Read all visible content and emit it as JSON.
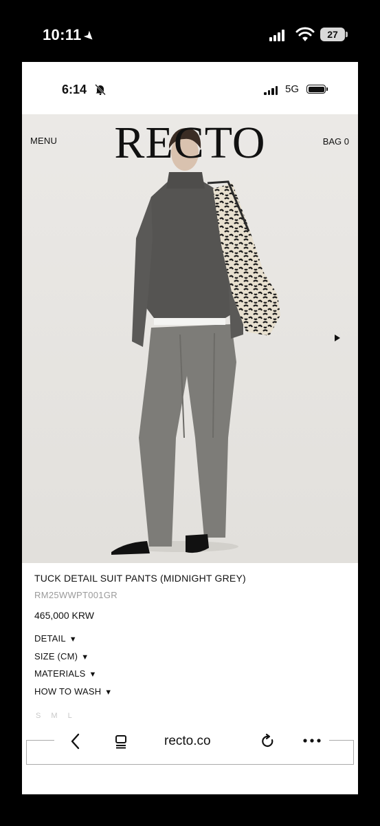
{
  "outer_status": {
    "time": "10:11",
    "location_icon": "location-arrow-icon",
    "battery": "27"
  },
  "inner_status": {
    "time": "6:14",
    "silent_icon": "bell-slash-icon",
    "network": "5G"
  },
  "header": {
    "menu_label": "MENU",
    "logo": "RECTO",
    "bag_label": "BAG 0"
  },
  "product": {
    "title": "TUCK DETAIL SUIT PANTS (MIDNIGHT GREY)",
    "sku": "RM25WWPT001GR",
    "price": "465,000 KRW",
    "accordion": [
      {
        "label": "DETAIL"
      },
      {
        "label": "SIZE (CM)"
      },
      {
        "label": "MATERIALS"
      },
      {
        "label": "HOW TO WASH"
      }
    ],
    "sizes_text": "S M L"
  },
  "browser": {
    "url": "recto.co"
  },
  "colors": {
    "background": "#000000",
    "page": "#ffffff",
    "hero_bg": "#e9e7e3",
    "text": "#111111",
    "muted": "#9a9a9a"
  }
}
